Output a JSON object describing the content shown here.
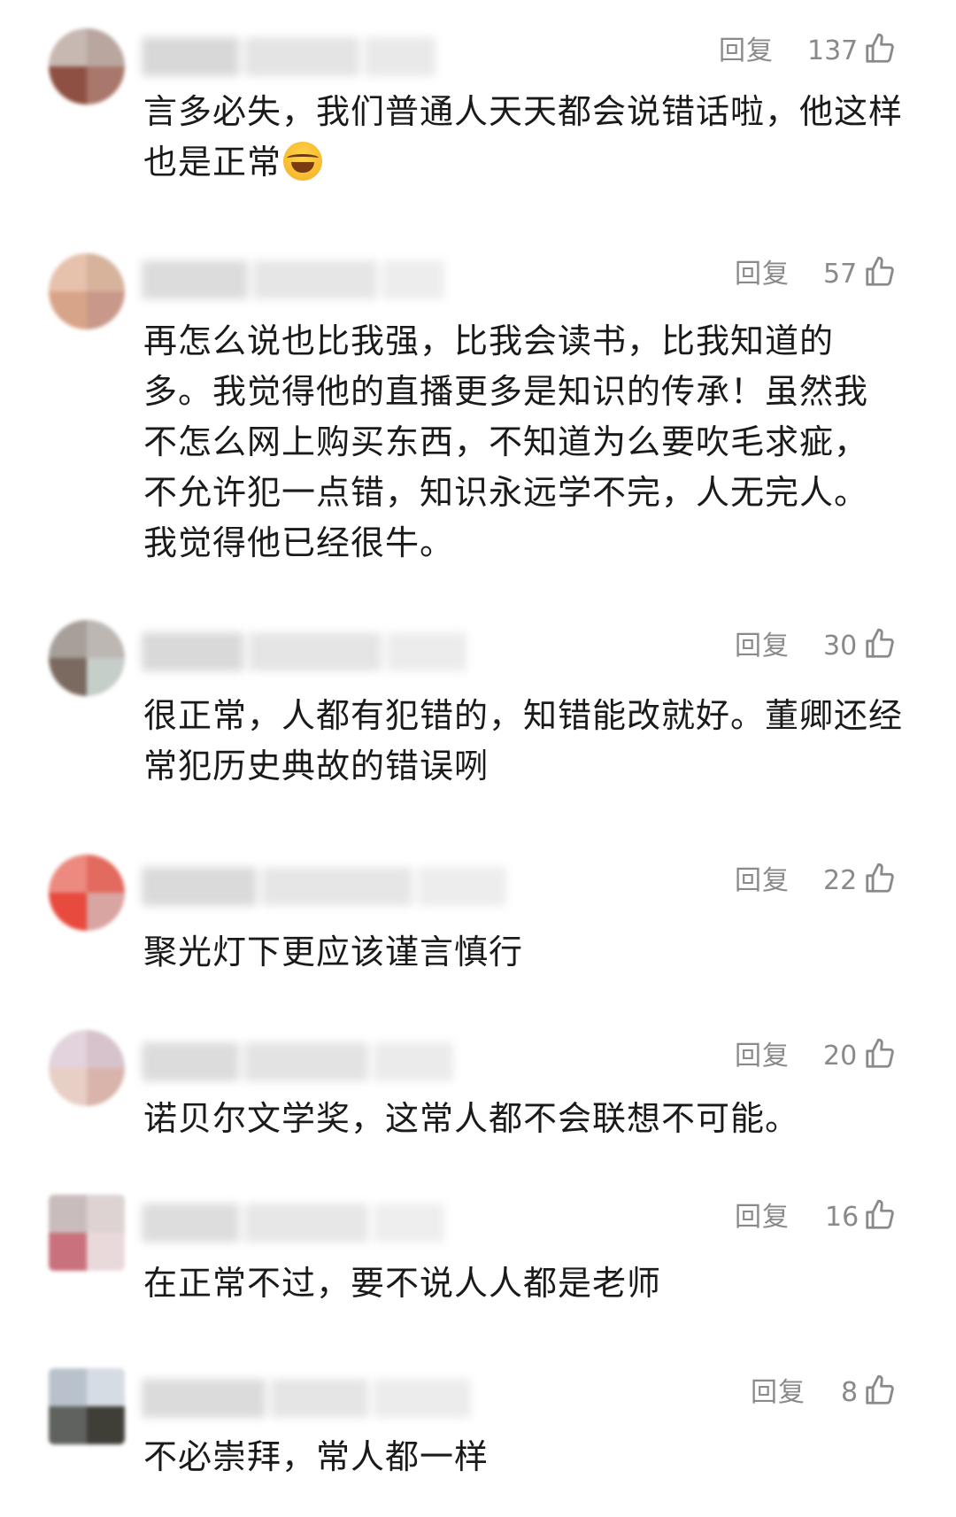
{
  "reply_label": "回复",
  "comments": [
    {
      "likes": "137",
      "text": "言多必失，我们普通人天天都会说错话啦，他这样也是正常",
      "emoji": "laughing-tears-emoji"
    },
    {
      "likes": "57",
      "text": "再怎么说也比我强，比我会读书，比我知道的多。我觉得他的直播更多是知识的传承！虽然我不怎么网上购买东西，不知道为么要吹毛求疵，不允许犯一点错，知识永远学不完，人无完人。我觉得他已经很牛。"
    },
    {
      "likes": "30",
      "text": "很正常，人都有犯错的，知错能改就好。董卿还经常犯历史典故的错误咧"
    },
    {
      "likes": "22",
      "text": "聚光灯下更应该谨言慎行"
    },
    {
      "likes": "20",
      "text": "诺贝尔文学奖，这常人都不会联想不可能。"
    },
    {
      "likes": "16",
      "text": "在正常不过，要不说人人都是老师"
    },
    {
      "likes": "8",
      "text": "不必崇拜，常人都一样"
    }
  ],
  "colors": {
    "text": "#1a1a1a",
    "meta": "#8a8a8a",
    "background": "#ffffff"
  }
}
